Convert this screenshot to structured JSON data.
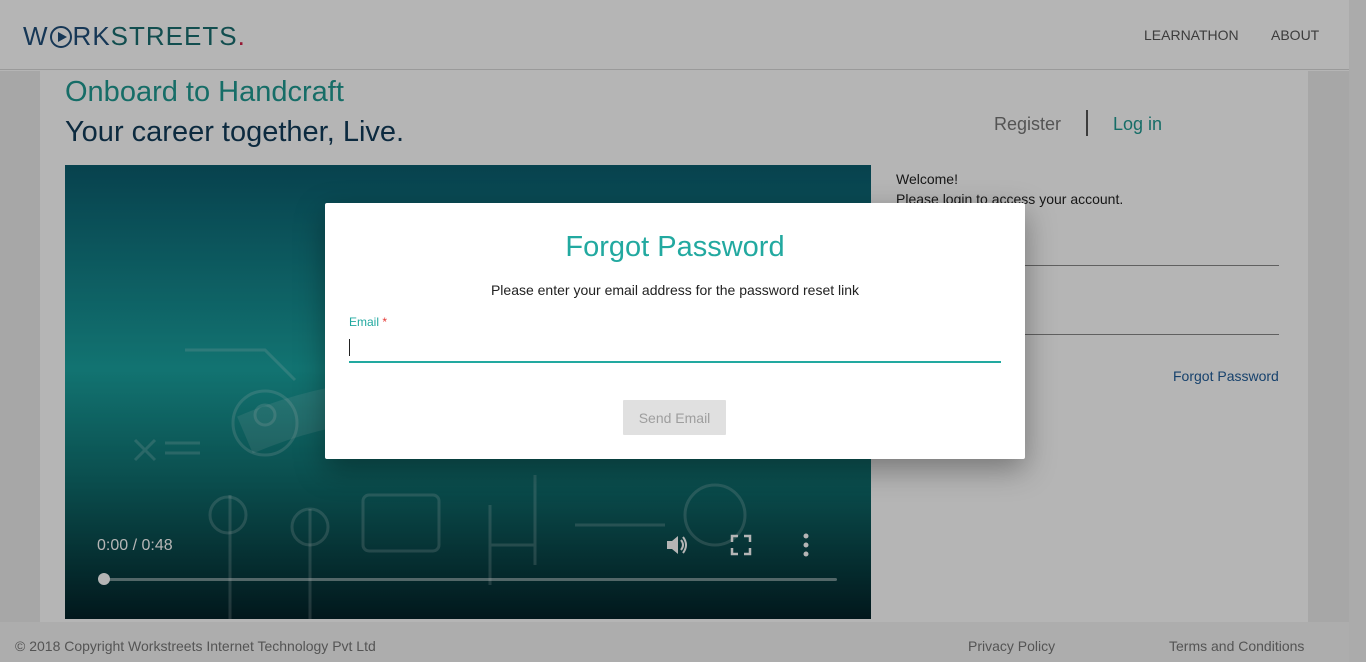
{
  "header": {
    "logo_part1": "W",
    "logo_part2": "RK",
    "logo_part3": "STREETS",
    "logo_dot": ".",
    "nav": [
      "LEARNATHON",
      "ABOUT"
    ]
  },
  "hero": {
    "title": "Onboard to Handcraft",
    "subtitle": "Your career together, Live."
  },
  "video": {
    "time": "0:00 / 0:48",
    "progress": 0,
    "icons": [
      "volume-icon",
      "fullscreen-icon",
      "more-options-icon"
    ]
  },
  "auth": {
    "register_tab": "Register",
    "login_tab": "Log in",
    "welcome_line1": "Welcome!",
    "welcome_line2": "Please login to access your account.",
    "forgot_link": "Forgot Password"
  },
  "footer": {
    "copyright": "© 2018 Copyright Workstreets Internet Technology Pvt Ltd",
    "privacy": "Privacy Policy",
    "terms": "Terms and Conditions"
  },
  "modal": {
    "title": "Forgot Password",
    "subtitle": "Please enter your email address for the password reset link",
    "email_label": "Email",
    "required_mark": "*",
    "email_value": "",
    "send_button": "Send Email"
  },
  "colors": {
    "accent": "#22a9a0",
    "brand_dark": "#123c5a",
    "required": "#e53935"
  }
}
